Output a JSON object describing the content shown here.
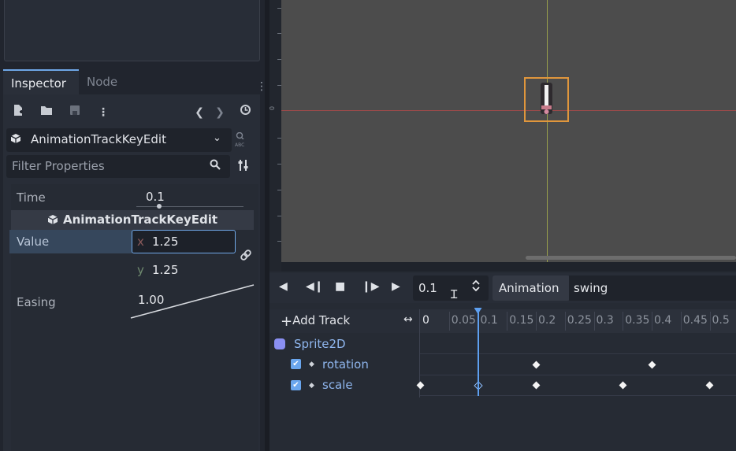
{
  "inspector": {
    "tab_inspector": "Inspector",
    "tab_node": "Node",
    "tab_menu": "⋮",
    "history_back": "❮",
    "history_forward": "❯",
    "resource_name": "AnimationTrackKeyEdit",
    "resource_chevron": "⌄",
    "doc_btn": "ABC",
    "filter_placeholder": "Filter Properties",
    "section_title": "AnimationTrackKeyEdit",
    "props": {
      "time_label": "Time",
      "time_value": "0.1",
      "value_label": "Value",
      "x_axis": "x",
      "x_value": "1.25",
      "y_axis": "y",
      "y_value": "1.25",
      "easing_label": "Easing",
      "easing_value": "1.00"
    }
  },
  "viewport": {
    "ruler_zero": "0",
    "axis_colors": {
      "x": "#a04a4a",
      "y": "#9aa04c"
    },
    "selection_color": "#e0963c"
  },
  "animation": {
    "time": "0.1",
    "animation_button": "Animation",
    "animation_name": "swing",
    "add_track": "Add Track",
    "ruler_labels": [
      "0",
      "0.05",
      "0.1",
      "0.15",
      "0.2",
      "0.25",
      "0.3",
      "0.35",
      "0.4",
      "0.45",
      "0.5"
    ],
    "node_name": "Sprite2D",
    "tracks": [
      {
        "name": "rotation",
        "enabled": true,
        "key_times": [
          0.2,
          0.4
        ]
      },
      {
        "name": "scale",
        "enabled": true,
        "key_times": [
          0,
          0.1,
          0.2,
          0.35,
          0.5
        ],
        "selected_key_time": 0.1
      }
    ],
    "playhead_time": 0.1
  },
  "colors": {
    "accent": "#6ea6e6",
    "track_name": "#8fb6ee",
    "playhead": "#5ea0f0"
  }
}
